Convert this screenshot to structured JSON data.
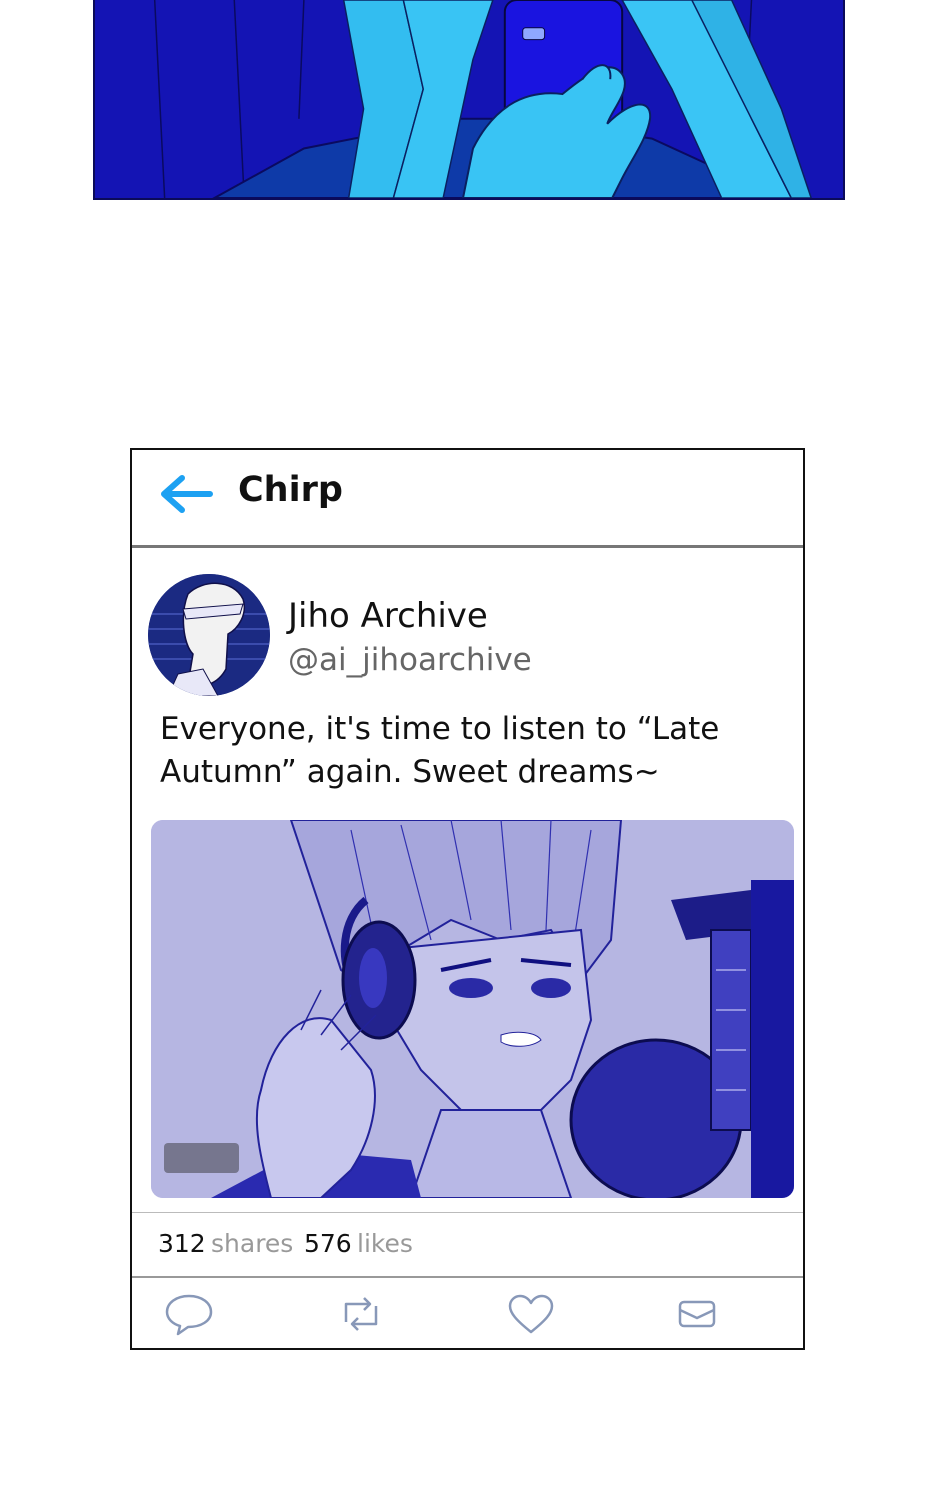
{
  "app": {
    "title": "Chirp"
  },
  "post": {
    "display_name": "Jiho Archive",
    "handle": "@ai_jihoarchive",
    "text_line1": "Everyone, it's time to listen to “Late",
    "text_line2": "Autumn” again. Sweet dreams~",
    "shares_count": "312",
    "shares_label": "shares",
    "likes_count": "576",
    "likes_label": "likes"
  },
  "icons": {
    "back": "back-arrow-icon",
    "reply": "speech-bubble-icon",
    "retweet": "retweet-icon",
    "like": "heart-icon",
    "message": "envelope-icon"
  },
  "colors": {
    "accent": "#1da1f2",
    "panel_blue": "#1212b8",
    "image_tint": "#b8b8e4"
  }
}
